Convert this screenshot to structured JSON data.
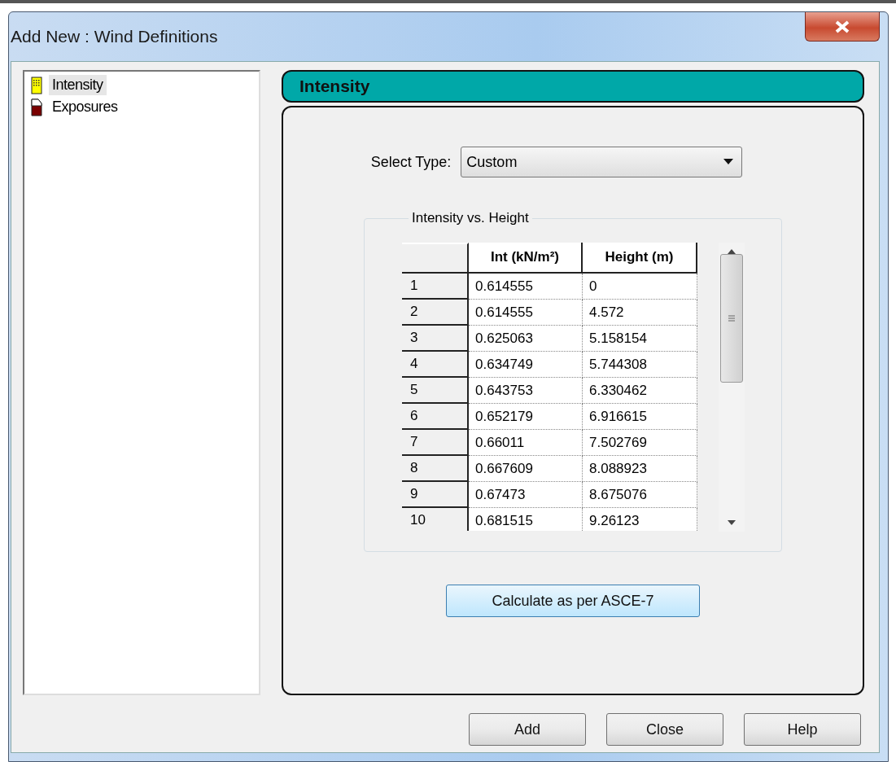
{
  "window": {
    "title": "Add New : Wind Definitions"
  },
  "tree": {
    "items": [
      {
        "label": "Intensity",
        "kind": "intensity",
        "selected": true
      },
      {
        "label": "Exposures",
        "kind": "exposures",
        "selected": false
      }
    ]
  },
  "panel": {
    "title": "Intensity",
    "select_type": {
      "label": "Select Type:",
      "value": "Custom"
    },
    "group": {
      "title": "Intensity vs. Height",
      "table": {
        "columns": [
          "Int (kN/m²)",
          "Height (m)"
        ],
        "rows": [
          {
            "index": "1",
            "cells": [
              "0.614555",
              "0"
            ]
          },
          {
            "index": "2",
            "cells": [
              "0.614555",
              "4.572"
            ]
          },
          {
            "index": "3",
            "cells": [
              "0.625063",
              "5.158154"
            ]
          },
          {
            "index": "4",
            "cells": [
              "0.634749",
              "5.744308"
            ]
          },
          {
            "index": "5",
            "cells": [
              "0.643753",
              "6.330462"
            ]
          },
          {
            "index": "6",
            "cells": [
              "0.652179",
              "6.916615"
            ]
          },
          {
            "index": "7",
            "cells": [
              "0.66011",
              "7.502769"
            ]
          },
          {
            "index": "8",
            "cells": [
              "0.667609",
              "8.088923"
            ]
          },
          {
            "index": "9",
            "cells": [
              "0.67473",
              "8.675076"
            ]
          },
          {
            "index": "10",
            "cells": [
              "0.681515",
              "9.26123"
            ]
          }
        ]
      }
    },
    "calculate_button": "Calculate as per ASCE-7"
  },
  "buttons": [
    "Add",
    "Close",
    "Help"
  ]
}
